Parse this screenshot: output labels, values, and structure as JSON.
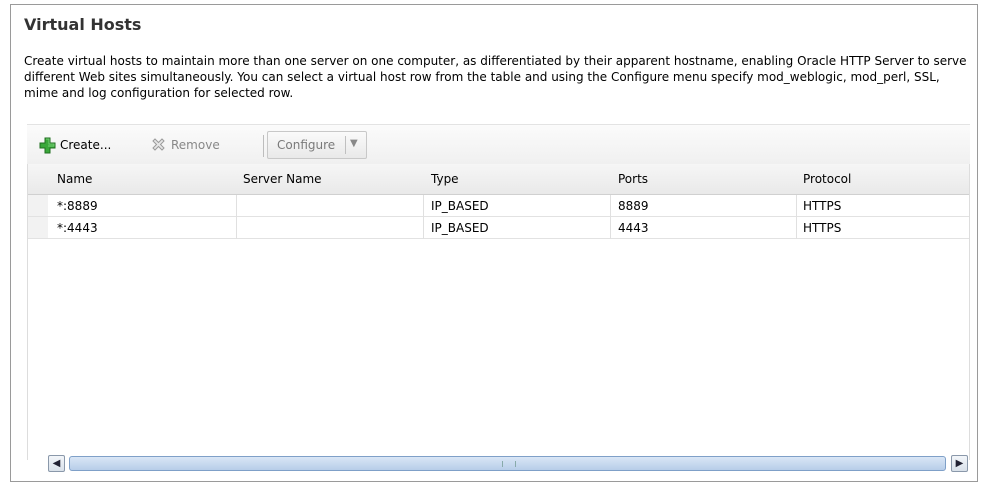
{
  "section": {
    "title": "Virtual Hosts",
    "description": "Create virtual hosts to maintain more than one server on one computer, as differentiated by their apparent hostname, enabling Oracle HTTP Server to serve different Web sites simultaneously. You can select a virtual host row from the table and using the Configure menu specify mod_weblogic, mod_perl, SSL, mime and log configuration for selected row."
  },
  "toolbar": {
    "create_label": "Create...",
    "remove_label": "Remove",
    "configure_label": "Configure",
    "create_icon": "plus-icon",
    "remove_icon": "remove-x-icon",
    "configure_icon": "chevron-down-icon",
    "accent_color": "#2e9b2e"
  },
  "table": {
    "columns": [
      "Name",
      "Server Name",
      "Type",
      "Ports",
      "Protocol"
    ],
    "rows": [
      {
        "name": "*:8889",
        "server_name": "",
        "type": "IP_BASED",
        "ports": "8889",
        "protocol": "HTTPS"
      },
      {
        "name": "*:4443",
        "server_name": "",
        "type": "IP_BASED",
        "ports": "4443",
        "protocol": "HTTPS"
      }
    ]
  },
  "scrollbar": {
    "left_icon": "arrow-left-icon",
    "right_icon": "arrow-right-icon"
  }
}
